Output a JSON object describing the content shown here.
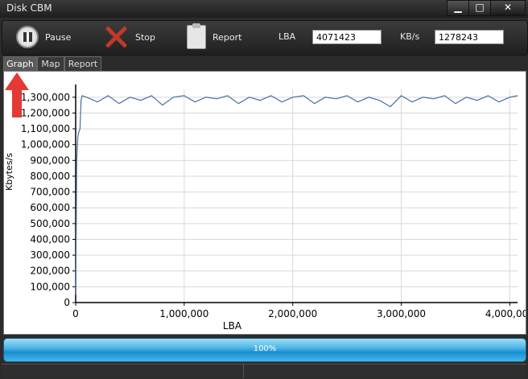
{
  "window": {
    "title": "Disk CBM"
  },
  "toolbar": {
    "pause_label": "Pause",
    "stop_label": "Stop",
    "report_label": "Report",
    "lba_label": "LBA",
    "lba_value": "4071423",
    "kbs_label": "KB/s",
    "kbs_value": "1278243"
  },
  "tabs": [
    {
      "label": "Graph",
      "active": true
    },
    {
      "label": "Map",
      "active": false
    },
    {
      "label": "Report",
      "active": false
    }
  ],
  "progress": {
    "value": 1.0,
    "label": "100%"
  },
  "colors": {
    "line": "#4a6fa5",
    "progress": "#1a8ed0",
    "arrow": "#e53935"
  },
  "chart_data": {
    "type": "line",
    "xlabel": "LBA",
    "ylabel": "Kbytes/s",
    "xlim": [
      0,
      4071423
    ],
    "ylim": [
      0,
      1350000
    ],
    "x_ticks": [
      "0",
      "1,000,000",
      "2,000,000",
      "3,000,000",
      "4,000,000"
    ],
    "y_ticks": [
      "0",
      "100,000",
      "200,000",
      "300,000",
      "400,000",
      "500,000",
      "600,000",
      "700,000",
      "800,000",
      "900,000",
      "1,000,000",
      "1,100,000",
      "1,200,000",
      "1,300,000"
    ],
    "grid": true,
    "series": [
      {
        "x": [
          0,
          5000,
          10000,
          20000,
          30000,
          40000,
          50000,
          60000,
          100000,
          200000,
          300000,
          400000,
          500000,
          600000,
          700000,
          800000,
          900000,
          1000000,
          1100000,
          1200000,
          1300000,
          1400000,
          1500000,
          1600000,
          1700000,
          1800000,
          1900000,
          2000000,
          2100000,
          2200000,
          2300000,
          2400000,
          2500000,
          2600000,
          2700000,
          2800000,
          2900000,
          3000000,
          3100000,
          3200000,
          3300000,
          3400000,
          3500000,
          3600000,
          3700000,
          3800000,
          3900000,
          4000000,
          4071423
        ],
        "y": [
          50000,
          450000,
          900000,
          1050000,
          1080000,
          1100000,
          1280000,
          1310000,
          1300000,
          1270000,
          1310000,
          1260000,
          1300000,
          1280000,
          1310000,
          1250000,
          1300000,
          1310000,
          1270000,
          1300000,
          1290000,
          1310000,
          1260000,
          1300000,
          1280000,
          1310000,
          1270000,
          1300000,
          1310000,
          1260000,
          1300000,
          1290000,
          1310000,
          1270000,
          1300000,
          1280000,
          1240000,
          1310000,
          1270000,
          1300000,
          1290000,
          1310000,
          1260000,
          1300000,
          1280000,
          1310000,
          1270000,
          1300000,
          1310000
        ]
      }
    ]
  }
}
